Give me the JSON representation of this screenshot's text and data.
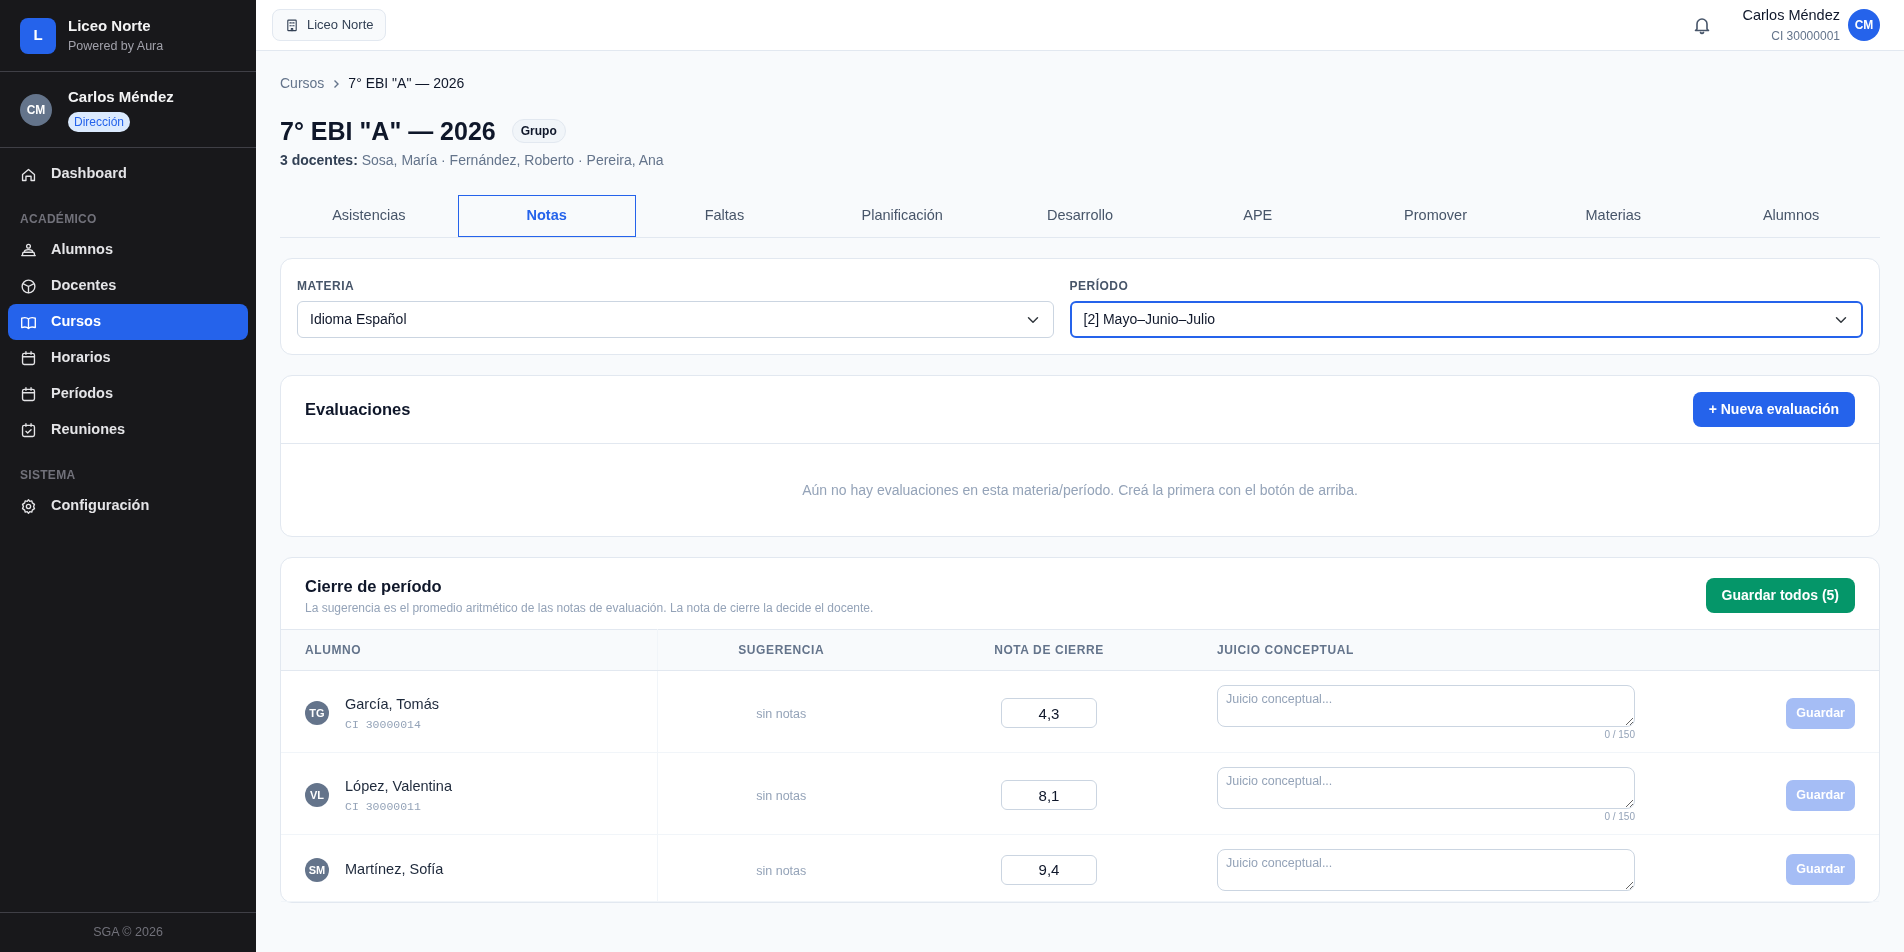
{
  "sidebar": {
    "brand": {
      "logo": "L",
      "name": "Liceo Norte",
      "subtitle": "Powered by Aura"
    },
    "user": {
      "initials": "CM",
      "name": "Carlos Méndez",
      "role": "Dirección"
    },
    "nav": [
      {
        "kind": "item",
        "label": "Dashboard",
        "selected": false
      },
      {
        "kind": "section",
        "label": "ACADÉMICO"
      },
      {
        "kind": "item",
        "label": "Alumnos",
        "selected": false
      },
      {
        "kind": "item",
        "label": "Docentes",
        "selected": false
      },
      {
        "kind": "item",
        "label": "Cursos",
        "selected": true
      },
      {
        "kind": "item",
        "label": "Horarios",
        "selected": false
      },
      {
        "kind": "item",
        "label": "Períodos",
        "selected": false
      },
      {
        "kind": "item",
        "label": "Reuniones",
        "selected": false
      },
      {
        "kind": "section",
        "label": "SISTEMA"
      },
      {
        "kind": "item",
        "label": "Configuración",
        "selected": false
      }
    ],
    "footer": "SGA © 2026"
  },
  "topbar": {
    "school_chip": "Liceo Norte",
    "user": {
      "name": "Carlos Méndez",
      "id": "CI 30000001",
      "initials": "CM"
    }
  },
  "breadcrumb": [
    "Cursos",
    "7° EBI \"A\" — 2026"
  ],
  "header": {
    "title": "7° EBI \"A\" — 2026",
    "badge": "Grupo",
    "docentes": "**3 docentes:** Sosa, María · Fernández, Roberto · Pereira, Ana"
  },
  "tabs": [
    {
      "label": "Asistencias",
      "selected": false
    },
    {
      "label": "Notas",
      "selected": true
    },
    {
      "label": "Faltas",
      "selected": false
    },
    {
      "label": "Planificación",
      "selected": false
    },
    {
      "label": "Desarrollo",
      "selected": false
    },
    {
      "label": "APE",
      "selected": false
    },
    {
      "label": "Promover",
      "selected": false
    },
    {
      "label": "Materias",
      "selected": false
    },
    {
      "label": "Alumnos",
      "selected": false
    }
  ],
  "filters": [
    {
      "label": "MATERIA",
      "value": "Idioma Español",
      "focused": false
    },
    {
      "label": "PERÍODO",
      "value": "[2] Mayo–Junio–Julio",
      "focused": true
    }
  ],
  "evaluaciones": {
    "title": "Evaluaciones",
    "button": "+ Nueva evaluación",
    "empty": "Aún no hay evaluaciones en esta materia/período. Creá la primera con el botón de arriba."
  },
  "cierre": {
    "title": "Cierre de período",
    "subtitle": "La sugerencia es el promedio aritmético de las notas de evaluación. La nota de cierre la decide el docente.",
    "button": "Guardar todos (5)",
    "columns": [
      "ALUMNO",
      "SUGERENCIA",
      "NOTA DE CIERRE",
      "JUICIO CONCEPTUAL"
    ],
    "rows": [
      {
        "initials": "TG",
        "name": "García, Tomás",
        "ci": "CI 30000014",
        "sugerencia": "sin notas",
        "nota": "4,3",
        "placeholder": "Juicio conceptual...",
        "counter": "0 / 150",
        "button": "Guardar",
        "disabled": true
      },
      {
        "initials": "VL",
        "name": "López, Valentina",
        "ci": "CI 30000011",
        "sugerencia": "sin notas",
        "nota": "8,1",
        "placeholder": "Juicio conceptual...",
        "counter": "0 / 150",
        "button": "Guardar",
        "disabled": true
      },
      {
        "initials": "SM",
        "name": "Martínez, Sofía",
        "sugerencia": "sin notas",
        "nota": "9,4",
        "placeholder": "Juicio conceptual...",
        "button": "Guardar",
        "disabled": true
      }
    ]
  }
}
